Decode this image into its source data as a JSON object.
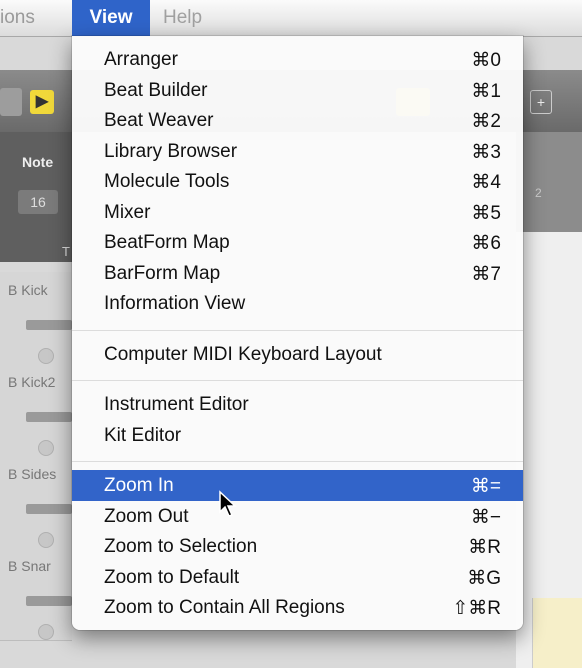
{
  "menubar": {
    "partial_left_label": "ions",
    "view_label": "View",
    "help_label": "Help"
  },
  "background": {
    "note_label": "Note",
    "note_value": "16",
    "track_header_letter": "T",
    "timeline_number": "2",
    "tracks": [
      {
        "name": "B Kick"
      },
      {
        "name": "B Kick2"
      },
      {
        "name": "B Sides"
      },
      {
        "name": "B Snar"
      }
    ]
  },
  "view_menu": {
    "groups": [
      [
        {
          "label": "Arranger",
          "shortcut": "⌘0"
        },
        {
          "label": "Beat Builder",
          "shortcut": "⌘1"
        },
        {
          "label": "Beat Weaver",
          "shortcut": "⌘2"
        },
        {
          "label": "Library Browser",
          "shortcut": "⌘3"
        },
        {
          "label": "Molecule Tools",
          "shortcut": "⌘4"
        },
        {
          "label": "Mixer",
          "shortcut": "⌘5"
        },
        {
          "label": "BeatForm Map",
          "shortcut": "⌘6"
        },
        {
          "label": "BarForm Map",
          "shortcut": "⌘7"
        },
        {
          "label": "Information View",
          "shortcut": ""
        }
      ],
      [
        {
          "label": "Computer MIDI Keyboard Layout",
          "shortcut": ""
        }
      ],
      [
        {
          "label": "Instrument Editor",
          "shortcut": ""
        },
        {
          "label": "Kit Editor",
          "shortcut": ""
        }
      ],
      [
        {
          "label": "Zoom In",
          "shortcut": "⌘=",
          "highlighted": true
        },
        {
          "label": "Zoom Out",
          "shortcut": "⌘−"
        },
        {
          "label": "Zoom to Selection",
          "shortcut": "⌘R"
        },
        {
          "label": "Zoom to Default",
          "shortcut": "⌘G"
        },
        {
          "label": "Zoom to Contain All Regions",
          "shortcut": "⇧⌘R"
        }
      ]
    ]
  },
  "colors": {
    "accent": "#3264c9",
    "toolbar_yellow": "#f0d83a"
  }
}
